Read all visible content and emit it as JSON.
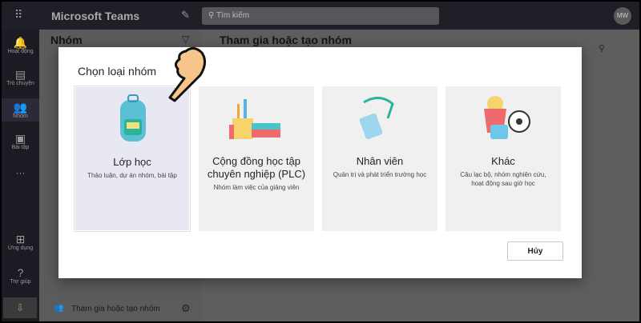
{
  "app": {
    "title": "Microsoft Teams",
    "search_placeholder": "Tìm kiếm",
    "avatar": "MW"
  },
  "rail": [
    {
      "label": "Hoạt động",
      "icon": "bell-icon"
    },
    {
      "label": "Trò chuyện",
      "icon": "chat-icon"
    },
    {
      "label": "Nhóm",
      "icon": "teams-icon"
    },
    {
      "label": "Bài tập",
      "icon": "assignments-icon"
    },
    {
      "label": "Ứng dụng",
      "icon": "apps-icon"
    },
    {
      "label": "Trợ giúp",
      "icon": "help-icon"
    }
  ],
  "left": {
    "title": "Nhóm",
    "join_create": "Tham gia hoặc tạo nhóm"
  },
  "main": {
    "title": "Tham gia hoặc tạo nhóm"
  },
  "modal": {
    "title": "Chọn loại nhóm",
    "cancel": "Hủy",
    "cards": [
      {
        "title": "Lớp học",
        "desc": "Thảo luận, dự án nhóm, bài tập"
      },
      {
        "title": "Cộng đồng học tập chuyên nghiệp (PLC)",
        "desc": "Nhóm làm việc của giảng viên"
      },
      {
        "title": "Nhân viên",
        "desc": "Quản trị và phát triển trường học"
      },
      {
        "title": "Khác",
        "desc": "Câu lạc bộ, nhóm nghiên cứu, hoạt động sau giờ học"
      }
    ]
  }
}
